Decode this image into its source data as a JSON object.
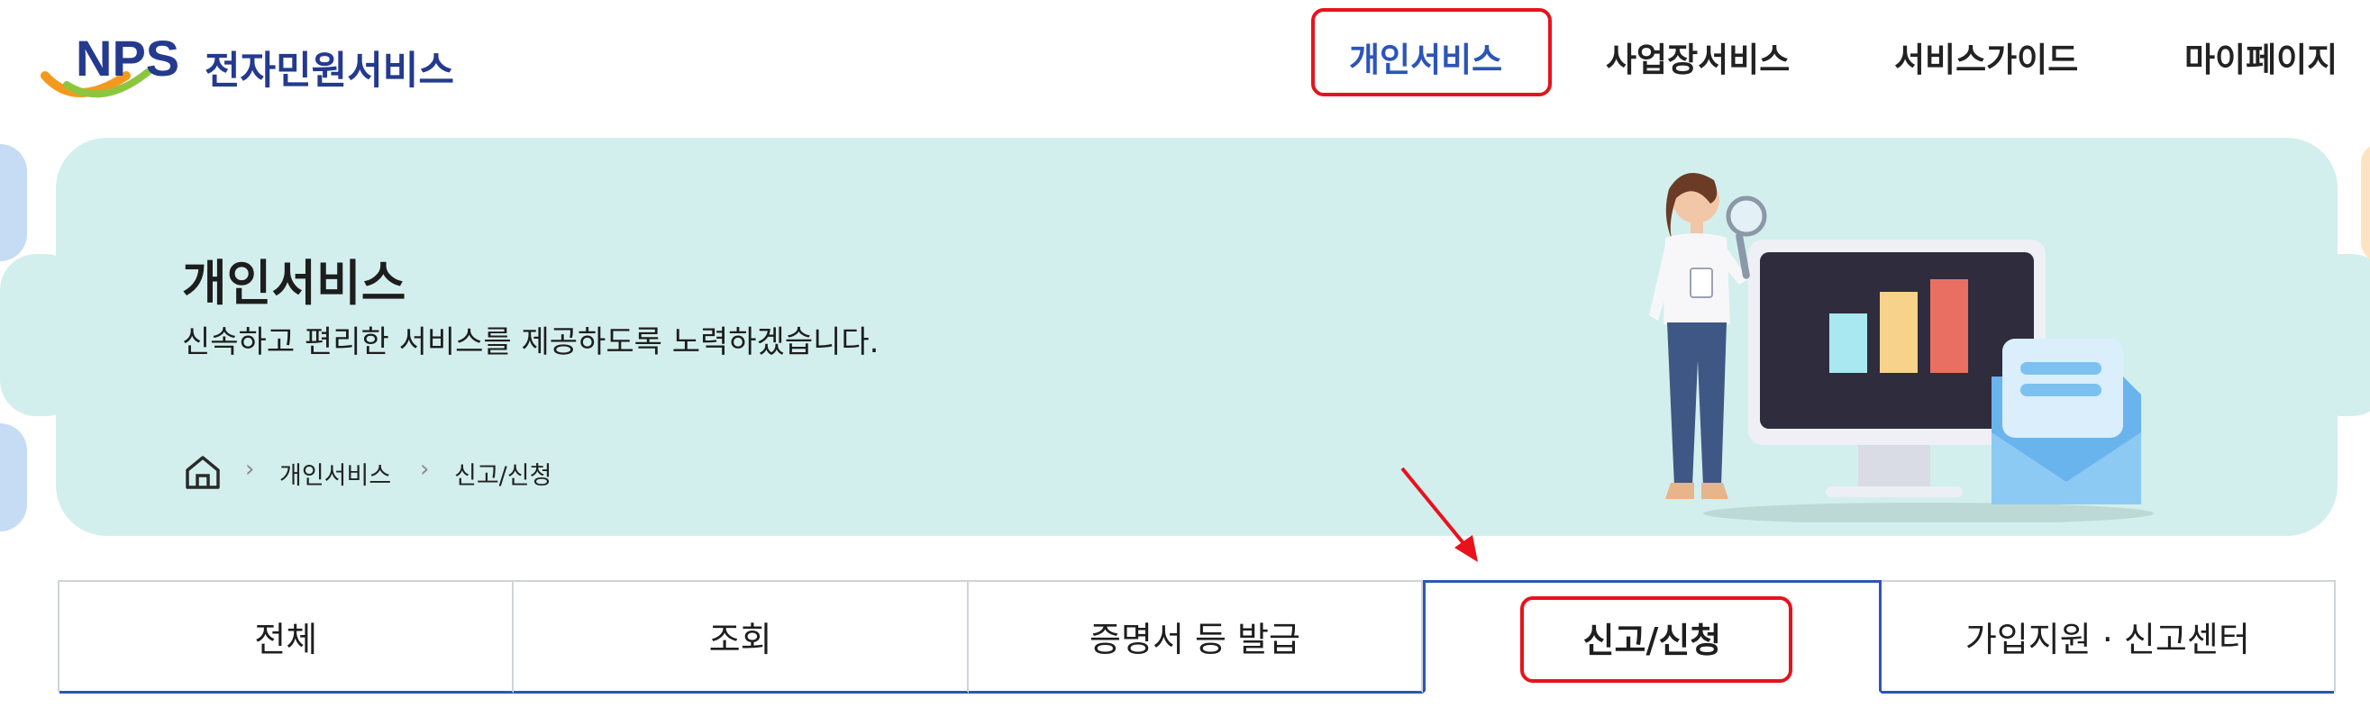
{
  "header": {
    "logo_text": "NPS",
    "logo_title": "전자민원서비스",
    "nav": [
      {
        "label": "개인서비스",
        "active": true
      },
      {
        "label": "사업장서비스",
        "active": false
      },
      {
        "label": "서비스가이드",
        "active": false
      },
      {
        "label": "마이페이지",
        "active": false
      }
    ]
  },
  "banner": {
    "title": "개인서비스",
    "subtitle": "신속하고 편리한 서비스를 제공하도록 노력하겠습니다.",
    "breadcrumb": [
      "개인서비스",
      "신고/신청"
    ]
  },
  "tabs": [
    {
      "label": "전체",
      "active": false
    },
    {
      "label": "조회",
      "active": false
    },
    {
      "label": "증명서 등 발급",
      "active": false
    },
    {
      "label": "신고/신청",
      "active": true
    },
    {
      "label": "가입지원 · 신고센터",
      "active": false
    }
  ],
  "colors": {
    "brand_blue": "#243a8f",
    "active_blue": "#2d55b8",
    "banner_bg": "#d3efed",
    "highlight_red": "#e8121c"
  }
}
